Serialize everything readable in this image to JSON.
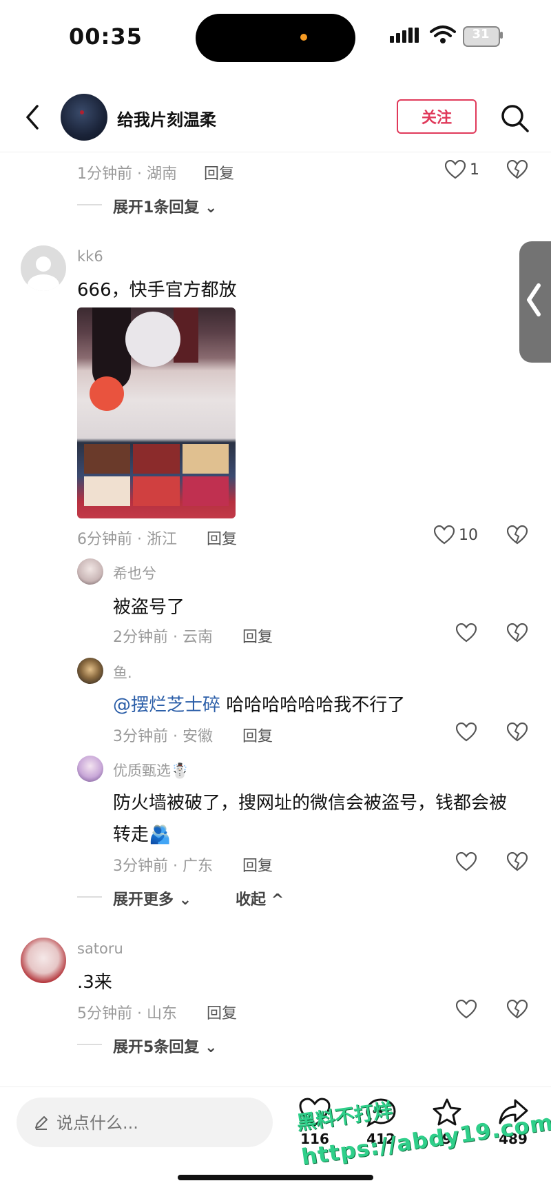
{
  "status_bar": {
    "time": "00:35",
    "battery": "31"
  },
  "header": {
    "title": "给我片刻温柔",
    "follow_label": "关注"
  },
  "comments": {
    "c0": {
      "meta": "1分钟前 · 湖南",
      "reply": "回复",
      "likes": "1",
      "expand": "展开1条回复"
    },
    "c1": {
      "user": "kk6",
      "text": "666，快手官方都放",
      "meta": "6分钟前 · 浙江",
      "reply": "回复",
      "likes": "10",
      "replies": [
        {
          "user": "希也兮",
          "text": "被盗号了",
          "meta": "2分钟前 · 云南",
          "reply": "回复"
        },
        {
          "user": "鱼.",
          "mention": "@摆烂芝士碎",
          "text": " 哈哈哈哈哈哈我不行了",
          "meta": "3分钟前 · 安徽",
          "reply": "回复"
        },
        {
          "user": "优质甄选",
          "user_emoji": "☃️",
          "text_line1": "防火墙被破了，搜网址的微信会被盗号，钱都会被",
          "text_line2": "转走",
          "text_emoji": "🫂",
          "meta": "3分钟前 · 广东",
          "reply": "回复"
        }
      ],
      "expand_more": "展开更多",
      "collapse": "收起"
    },
    "c2": {
      "user": "satoru",
      "text": ".3来",
      "meta": "5分钟前 · 山东",
      "reply": "回复",
      "expand": "展开5条回复"
    }
  },
  "bottom_bar": {
    "input_placeholder": "说点什么...",
    "like_count": "116",
    "comment_count": "412",
    "star_count": "9",
    "share_count": "489"
  },
  "watermark": {
    "line1": "黑料不打烊",
    "line2": "https://abdy19.com"
  }
}
